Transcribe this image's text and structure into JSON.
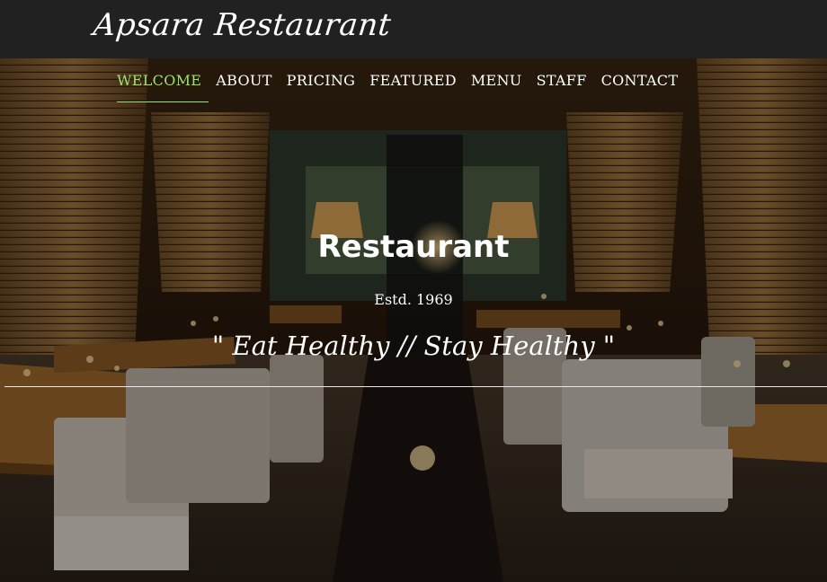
{
  "header": {
    "brand": "Apsara Restaurant"
  },
  "nav": {
    "items": [
      {
        "label": "WELCOME",
        "active": true
      },
      {
        "label": "ABOUT"
      },
      {
        "label": "PRICING"
      },
      {
        "label": "FEATURED"
      },
      {
        "label": "MENU"
      },
      {
        "label": "STAFF"
      },
      {
        "label": "CONTACT"
      }
    ]
  },
  "hero": {
    "title": "Restaurant",
    "established": "Estd. 1969",
    "tagline": "\" Eat Healthy // Stay Healthy \""
  },
  "colors": {
    "topbar": "#212121",
    "active_nav": "#9be36d",
    "text": "#ffffff"
  }
}
